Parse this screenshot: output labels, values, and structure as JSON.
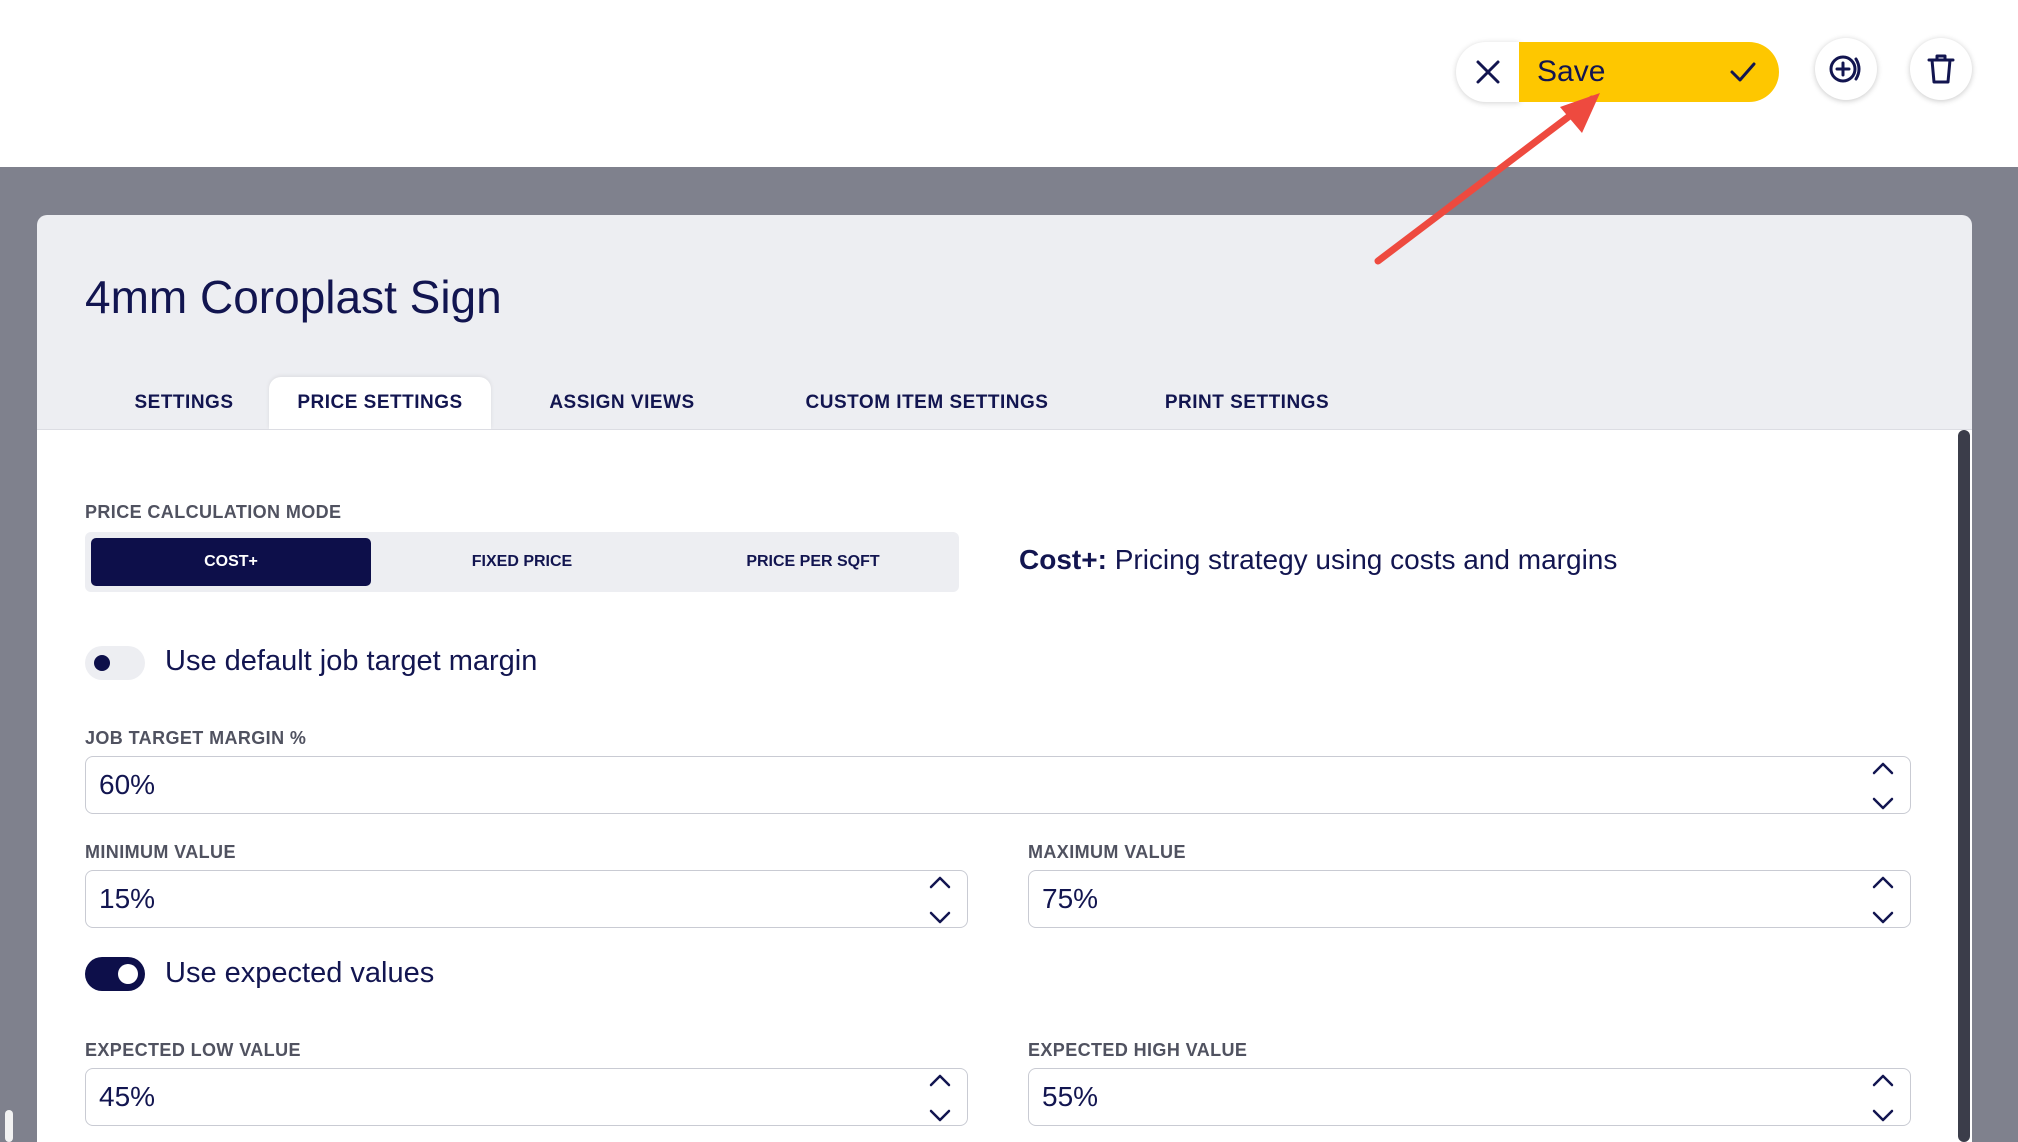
{
  "toolbar": {
    "close_icon": "close-icon",
    "save_label": "Save",
    "save_check_icon": "check-icon",
    "add_icon": "add-circle-icon",
    "delete_icon": "trash-icon",
    "accent_color": "#fec700"
  },
  "item": {
    "title": "4mm Coroplast Sign"
  },
  "tabs": [
    {
      "label": "SETTINGS",
      "active": false
    },
    {
      "label": "PRICE SETTINGS",
      "active": true
    },
    {
      "label": "ASSIGN VIEWS",
      "active": false
    },
    {
      "label": "CUSTOM ITEM SETTINGS",
      "active": false
    },
    {
      "label": "PRINT SETTINGS",
      "active": false
    }
  ],
  "price_settings": {
    "mode_label": "PRICE CALCULATION MODE",
    "modes": [
      {
        "label": "COST+",
        "selected": true
      },
      {
        "label": "FIXED PRICE",
        "selected": false
      },
      {
        "label": "PRICE PER SQFT",
        "selected": false
      }
    ],
    "mode_desc_title": "Cost+:",
    "mode_desc_text": "Pricing strategy using costs and margins",
    "use_default_margin": {
      "label": "Use default job target margin",
      "enabled": false
    },
    "job_target_margin": {
      "label": "JOB TARGET MARGIN %",
      "value": "60%"
    },
    "minimum_value": {
      "label": "MINIMUM VALUE",
      "value": "15%"
    },
    "maximum_value": {
      "label": "MAXIMUM VALUE",
      "value": "75%"
    },
    "use_expected_values": {
      "label": "Use expected values",
      "enabled": true
    },
    "expected_low": {
      "label": "EXPECTED LOW VALUE",
      "value": "45%"
    },
    "expected_high": {
      "label": "EXPECTED HIGH VALUE",
      "value": "55%"
    }
  },
  "colors": {
    "navy": "#0d0f4a",
    "backdrop": "#7f818d",
    "annotation_arrow": "#ee4a3f"
  }
}
